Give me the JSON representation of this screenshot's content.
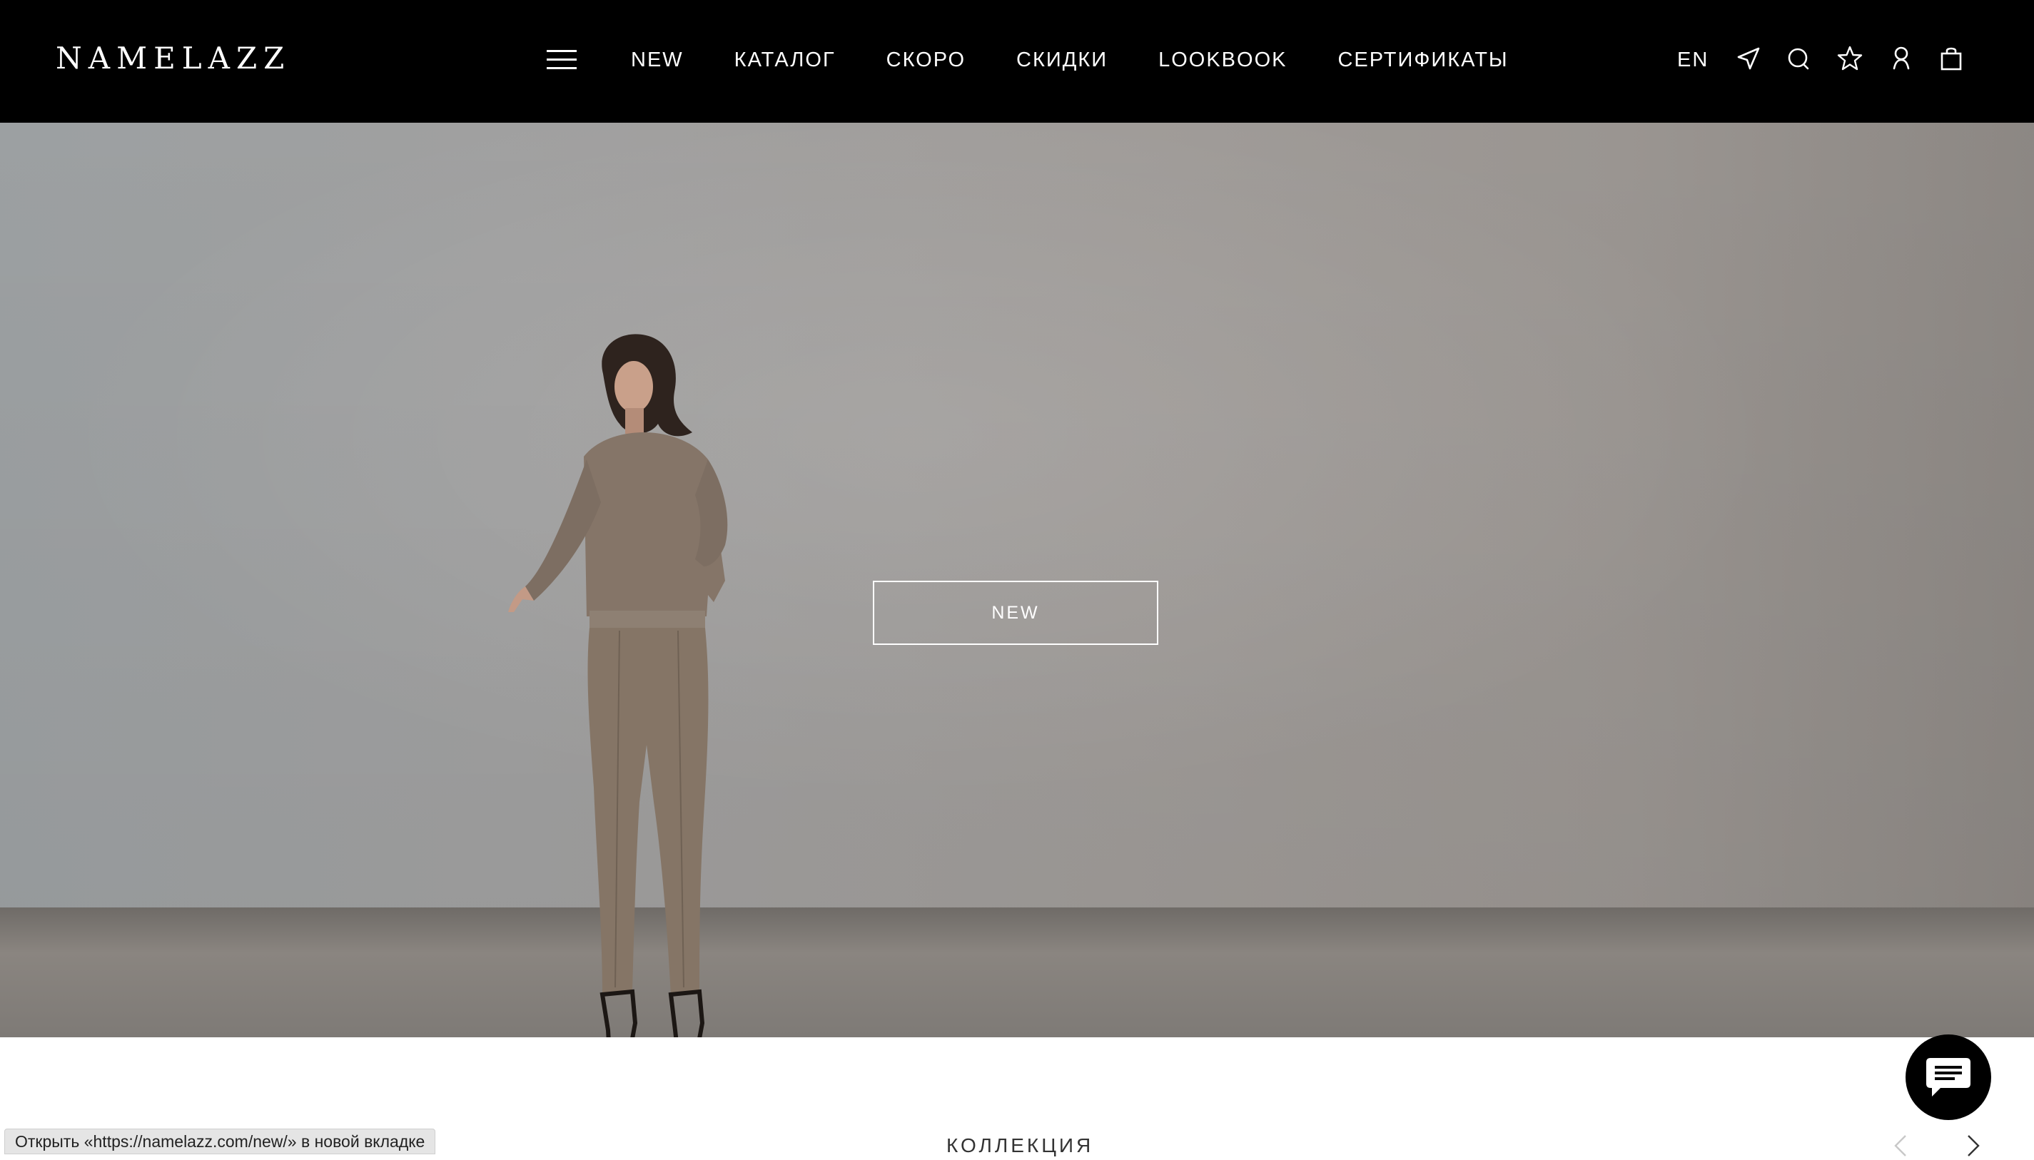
{
  "header": {
    "logo": "NAMELAZZ",
    "nav": [
      "NEW",
      "КАТАЛОГ",
      "СКОРО",
      "СКИДКИ",
      "LOOKBOOK",
      "СЕРТИФИКАТЫ"
    ],
    "lang": "EN",
    "icons": [
      "menu-icon",
      "location-arrow-icon",
      "search-icon",
      "favorites-star-icon",
      "account-user-icon",
      "shopping-bag-icon"
    ]
  },
  "hero": {
    "button_label": "NEW"
  },
  "section": {
    "title": "КОЛЛЕКЦИЯ"
  },
  "carousel": {
    "icons": [
      "chevron-left-icon",
      "chevron-right-icon"
    ]
  },
  "chat": {
    "icon": "chat-bubble-icon"
  },
  "status_bar": {
    "text": "Открыть «https://namelazz.com/new/» в новой вкладке"
  },
  "colors": {
    "header_bg": "#000000",
    "header_text": "#ffffff",
    "hero_wall": "#a3a3a3",
    "chat_button": "#000000"
  }
}
